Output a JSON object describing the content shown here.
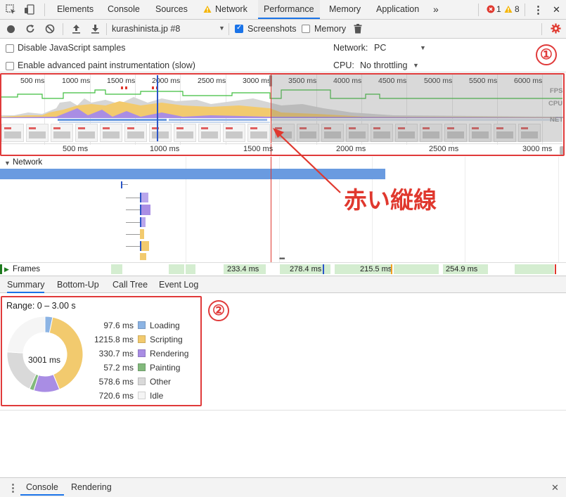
{
  "tabs": [
    {
      "label": "Elements",
      "active": false
    },
    {
      "label": "Console",
      "active": false
    },
    {
      "label": "Sources",
      "active": false
    },
    {
      "label": "Network",
      "active": false
    },
    {
      "label": "Performance",
      "active": true
    },
    {
      "label": "Memory",
      "active": false
    },
    {
      "label": "Application",
      "active": false
    }
  ],
  "tabbar": {
    "more": "»",
    "errors": "1",
    "warnings": "8",
    "menu": "⋮",
    "close": "✕"
  },
  "toolbar": {
    "profile_select": "kurashinista.jp #8",
    "screenshots_label": "Screenshots",
    "screenshots_checked": true,
    "memory_label": "Memory",
    "memory_checked": false
  },
  "settings": {
    "disable_js_label": "Disable JavaScript samples",
    "paint_label": "Enable advanced paint instrumentation (slow)",
    "network_label": "Network:",
    "network_value": "PC",
    "cpu_label": "CPU:",
    "cpu_value": "No throttling"
  },
  "overview": {
    "top_ticks": [
      "500 ms",
      "1000 ms",
      "1500 ms",
      "2000 ms",
      "2500 ms",
      "3000 ms",
      "3500 ms",
      "4000 ms",
      "4500 ms",
      "5000 ms",
      "5500 ms",
      "6000 ms"
    ],
    "bottom_ticks": [
      "500 ms",
      "1000 ms",
      "1500 ms",
      "2000 ms",
      "2500 ms",
      "3000 ms"
    ],
    "track_labels": [
      "FPS",
      "CPU",
      "NET"
    ],
    "selection_end_ms": 3000
  },
  "network_section": {
    "label": "Network"
  },
  "frames": {
    "label": "Frames",
    "durations": [
      "233.4 ms",
      "278.4 ms",
      "215.5 ms",
      "254.9 ms"
    ]
  },
  "bottom_tabs": [
    {
      "label": "Summary",
      "active": true
    },
    {
      "label": "Bottom-Up",
      "active": false
    },
    {
      "label": "Call Tree",
      "active": false
    },
    {
      "label": "Event Log",
      "active": false
    }
  ],
  "summary": {
    "range": "Range: 0 – 3.00 s",
    "total": "3001 ms",
    "rows": [
      {
        "value": "97.6 ms",
        "name": "Loading",
        "ms": 97.6,
        "color": "#8cb4e4"
      },
      {
        "value": "1215.8 ms",
        "name": "Scripting",
        "ms": 1215.8,
        "color": "#f2ca6e"
      },
      {
        "value": "330.7 ms",
        "name": "Rendering",
        "ms": 330.7,
        "color": "#a98de4"
      },
      {
        "value": "57.2 ms",
        "name": "Painting",
        "ms": 57.2,
        "color": "#82b97c"
      },
      {
        "value": "578.6 ms",
        "name": "Other",
        "ms": 578.6,
        "color": "#d9d9d9"
      },
      {
        "value": "720.6 ms",
        "name": "Idle",
        "ms": 720.6,
        "color": "#f5f5f5"
      }
    ]
  },
  "annotations": {
    "label": "赤い縦線",
    "marker_1": "①",
    "marker_2": "②",
    "red_color": "#e03a3a"
  },
  "drawer": {
    "tabs": [
      {
        "label": "Console",
        "active": true
      },
      {
        "label": "Rendering",
        "active": false
      }
    ],
    "menu": "⋮",
    "close": "✕"
  }
}
